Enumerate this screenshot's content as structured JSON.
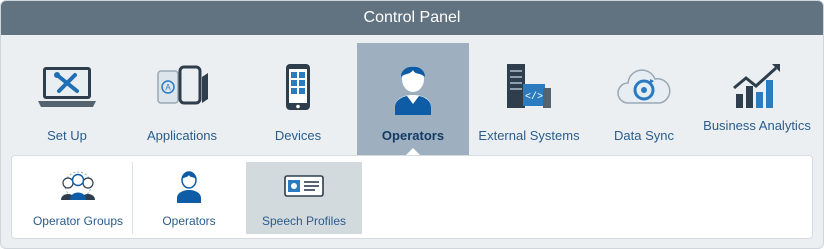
{
  "window": {
    "title": "Control Panel"
  },
  "main_tabs": [
    {
      "label": "Set Up",
      "icon": "laptop-tools-icon"
    },
    {
      "label": "Applications",
      "icon": "applications-icon"
    },
    {
      "label": "Devices",
      "icon": "mobile-device-icon"
    },
    {
      "label": "Operators",
      "icon": "operator-person-icon",
      "selected": true
    },
    {
      "label": "External Systems",
      "icon": "server-icon"
    },
    {
      "label": "Data Sync",
      "icon": "cloud-sync-icon"
    },
    {
      "label": "Business Analytics",
      "icon": "analytics-chart-icon"
    }
  ],
  "sub_tabs": [
    {
      "label": "Operator Groups",
      "icon": "operator-groups-icon"
    },
    {
      "label": "Operators",
      "icon": "operator-icon"
    },
    {
      "label": "Speech Profiles",
      "icon": "speech-profile-icon",
      "selected": true
    }
  ],
  "colors": {
    "titlebar": "#617381",
    "accent": "#2a5c8c",
    "selected_tab": "#9eb0bf"
  }
}
